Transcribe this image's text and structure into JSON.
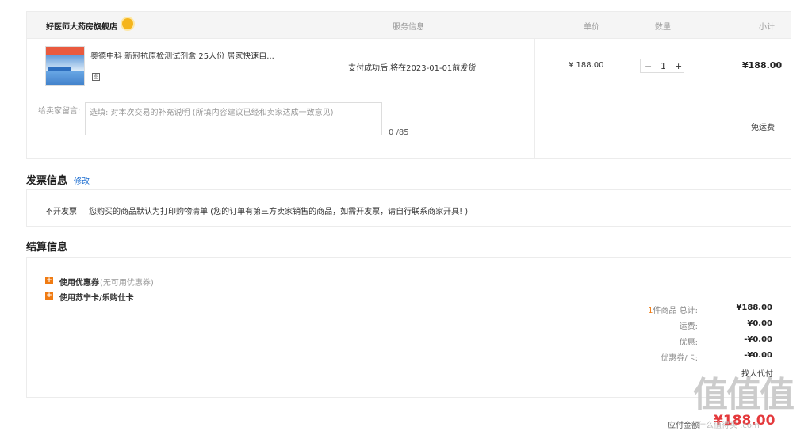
{
  "order": {
    "store_name": "好医师大药房旗舰店",
    "headers": {
      "service": "服务信息",
      "unit_price": "单价",
      "quantity": "数量",
      "subtotal": "小计"
    },
    "item": {
      "title": "奥德中科 新冠抗原检测试剂盒 25人份 居家快速自...",
      "service_info": "支付成功后,将在2023-01-01前发货",
      "unit_price": "¥ 188.00",
      "qty_minus": "−",
      "quantity": "1",
      "qty_plus": "+",
      "subtotal": "¥188.00",
      "badge_glyph": "图"
    },
    "message": {
      "label": "给卖家留言:",
      "placeholder": "选填: 对本次交易的补充说明 (所填内容建议已经和卖家达成一致意见)",
      "counter": "0 /85"
    },
    "shipping": "免运费"
  },
  "invoice": {
    "title": "发票信息",
    "edit": "修改",
    "type": "不开发票",
    "note": "您购买的商品默认为打印购物清单 (您的订单有第三方卖家销售的商品，如需开发票，请自行联系商家开具! )"
  },
  "settlement": {
    "title": "结算信息",
    "coupon_label": "使用优惠券",
    "coupon_note": "(无可用优惠券)",
    "card_label": "使用苏宁卡/乐购仕卡",
    "summary": [
      {
        "label_prefix": "1",
        "label": "件商品 总计:",
        "value": "¥188.00"
      },
      {
        "label_prefix": "",
        "label": "运费:",
        "value": "¥0.00"
      },
      {
        "label_prefix": "",
        "label": "优惠:",
        "value": "-¥0.00"
      },
      {
        "label_prefix": "",
        "label": "优惠券/卡:",
        "value": "-¥0.00"
      }
    ],
    "partial_text": "找人代付",
    "payable_label": "应付金额",
    "payable_value": "¥188.00"
  },
  "watermark": {
    "glyphs": "值值值",
    "domain": "什么值得买 .com"
  },
  "colors": {
    "accent": "#f07b12",
    "link": "#1f6fd1",
    "price_red": "#e4393c"
  }
}
